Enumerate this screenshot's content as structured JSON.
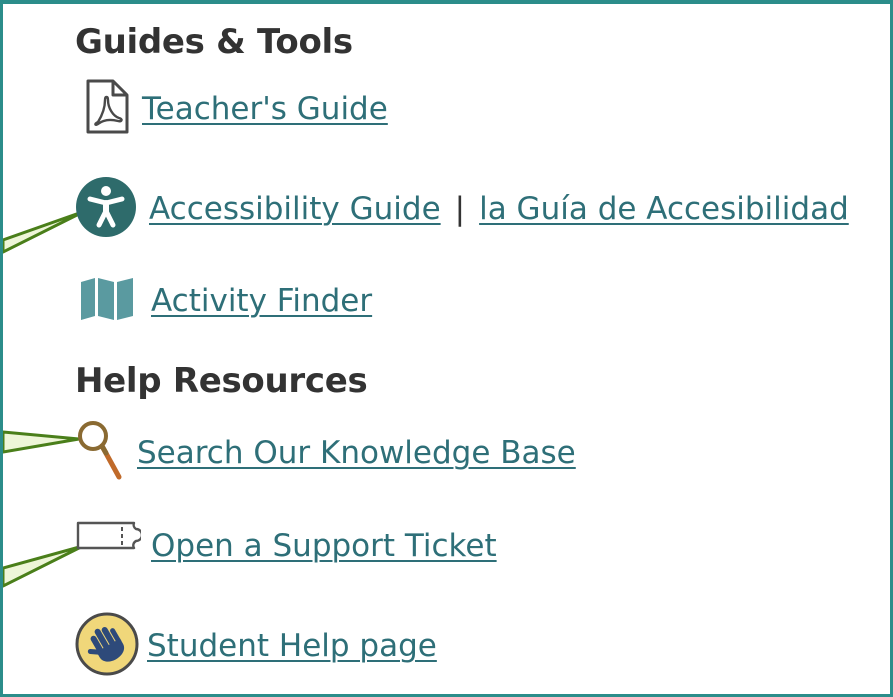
{
  "sections": {
    "guides_heading": "Guides & Tools",
    "help_heading": "Help Resources"
  },
  "links": {
    "teachers_guide": "Teacher's Guide",
    "accessibility_guide": "Accessibility Guide",
    "separator": "|",
    "guia_accesibilidad": "la Guía de Accesibilidad",
    "activity_finder": "Activity Finder",
    "knowledge_base": "Search Our Knowledge Base",
    "support_ticket": "Open a Support Ticket",
    "student_help": "Student Help page"
  },
  "icons": {
    "teachers_guide": "pdf-document-icon",
    "accessibility": "accessibility-person-icon",
    "activity_finder": "map-icon",
    "knowledge_base": "magnifying-glass-icon",
    "support_ticket": "ticket-icon",
    "student_help": "waving-hand-icon"
  },
  "colors": {
    "border": "#2b8d8a",
    "link": "#2e6f78",
    "heading": "#333333",
    "accessibility_circle": "#2e6b6b",
    "map_icon": "#5a9aa0",
    "hand_circle": "#f0d77a",
    "pointer_fill": "#eef6d8",
    "pointer_stroke": "#4a7f1a"
  }
}
